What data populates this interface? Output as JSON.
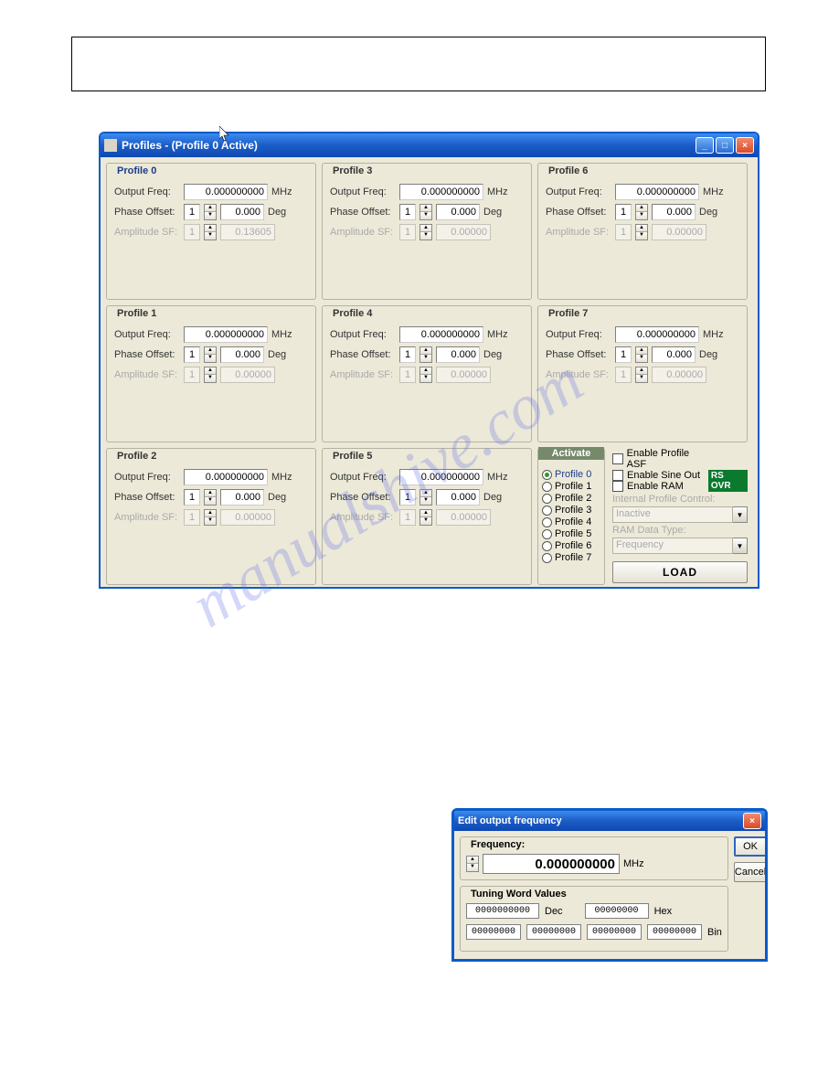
{
  "page": {
    "border_present": true
  },
  "watermark": "manualshive.com",
  "profiles_window": {
    "title": "Profiles - (Profile 0 Active)",
    "profiles": [
      {
        "name": "Profile 0",
        "active": true,
        "freq": "0.000000000",
        "freq_unit": "MHz",
        "phase_n": "1",
        "phase": "0.000",
        "phase_unit": "Deg",
        "amp_n": "1",
        "amp": "0.13605"
      },
      {
        "name": "Profile 1",
        "active": false,
        "freq": "0.000000000",
        "freq_unit": "MHz",
        "phase_n": "1",
        "phase": "0.000",
        "phase_unit": "Deg",
        "amp_n": "1",
        "amp": "0.00000"
      },
      {
        "name": "Profile 2",
        "active": false,
        "freq": "0.000000000",
        "freq_unit": "MHz",
        "phase_n": "1",
        "phase": "0.000",
        "phase_unit": "Deg",
        "amp_n": "1",
        "amp": "0.00000"
      },
      {
        "name": "Profile 3",
        "active": false,
        "freq": "0.000000000",
        "freq_unit": "MHz",
        "phase_n": "1",
        "phase": "0.000",
        "phase_unit": "Deg",
        "amp_n": "1",
        "amp": "0.00000"
      },
      {
        "name": "Profile 4",
        "active": false,
        "freq": "0.000000000",
        "freq_unit": "MHz",
        "phase_n": "1",
        "phase": "0.000",
        "phase_unit": "Deg",
        "amp_n": "1",
        "amp": "0.00000"
      },
      {
        "name": "Profile 5",
        "active": false,
        "freq": "0.000000000",
        "freq_unit": "MHz",
        "phase_n": "1",
        "phase": "0.000",
        "phase_unit": "Deg",
        "amp_n": "1",
        "amp": "0.00000"
      },
      {
        "name": "Profile 6",
        "active": false,
        "freq": "0.000000000",
        "freq_unit": "MHz",
        "phase_n": "1",
        "phase": "0.000",
        "phase_unit": "Deg",
        "amp_n": "1",
        "amp": "0.00000"
      },
      {
        "name": "Profile 7",
        "active": false,
        "freq": "0.000000000",
        "freq_unit": "MHz",
        "phase_n": "1",
        "phase": "0.000",
        "phase_unit": "Deg",
        "amp_n": "1",
        "amp": "0.00000"
      }
    ],
    "labels": {
      "output_freq": "Output Freq:",
      "phase_offset": "Phase Offset:",
      "amplitude_sf": "Amplitude SF:"
    },
    "activate": {
      "title": "Activate",
      "options": [
        "Profile 0",
        "Profile 1",
        "Profile 2",
        "Profile 3",
        "Profile 4",
        "Profile 5",
        "Profile 6",
        "Profile 7"
      ],
      "selected": 0
    },
    "checks": {
      "enable_profile_asf": "Enable Profile ASF",
      "enable_sine_out": "Enable Sine Out",
      "enable_ram": "Enable RAM"
    },
    "badge": "RS OVR",
    "ipc_label": "Internal Profile Control:",
    "ipc_value": "Inactive",
    "ram_label": "RAM Data Type:",
    "ram_value": "Frequency",
    "load_button": "LOAD"
  },
  "edit_dialog": {
    "title": "Edit output frequency",
    "frequency_label": "Frequency:",
    "frequency_value": "0.000000000",
    "frequency_unit": "MHz",
    "twv_label": "Tuning Word Values",
    "dec_value": "0000000000",
    "dec_label": "Dec",
    "hex_value": "00000000",
    "hex_label": "Hex",
    "bin_values": [
      "00000000",
      "00000000",
      "00000000",
      "00000000"
    ],
    "bin_label": "Bin",
    "ok": "OK",
    "cancel": "Cancel"
  }
}
